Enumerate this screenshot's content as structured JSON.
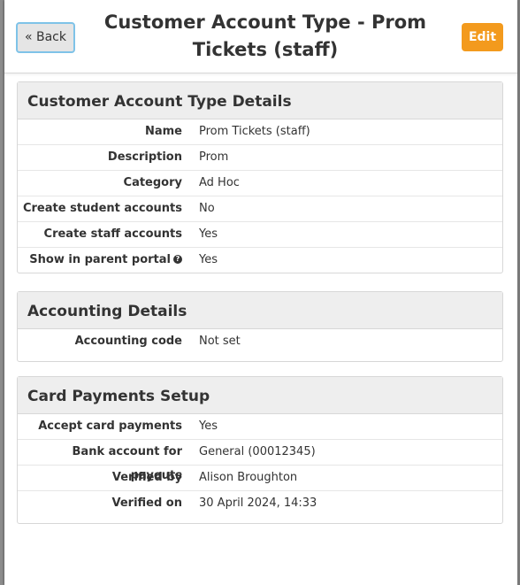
{
  "header": {
    "back_label": "« Back",
    "title": "Customer Account Type - Prom Tickets (staff)",
    "edit_label": "Edit"
  },
  "details": {
    "heading": "Customer Account Type Details",
    "rows": [
      {
        "label": "Name",
        "value": "Prom Tickets (staff)"
      },
      {
        "label": "Description",
        "value": "Prom"
      },
      {
        "label": "Category",
        "value": "Ad Hoc"
      },
      {
        "label": "Create student accounts",
        "value": "No"
      },
      {
        "label": "Create staff accounts",
        "value": "Yes"
      },
      {
        "label": "Show in parent portal",
        "value": "Yes",
        "icon": "help-icon"
      }
    ]
  },
  "accounting": {
    "heading": "Accounting Details",
    "rows": [
      {
        "label": "Accounting code",
        "value": "Not set"
      }
    ]
  },
  "card_payments": {
    "heading": "Card Payments Setup",
    "rows": [
      {
        "label": "Accept card payments",
        "value": "Yes"
      },
      {
        "label": "Bank account for payouts",
        "value": "General (00012345)"
      },
      {
        "label": "Verified by",
        "value": "Alison Broughton"
      },
      {
        "label": "Verified on",
        "value": "30 April 2024, 14:33"
      }
    ]
  },
  "colors": {
    "edit_button": "#f39a1d",
    "back_button_border": "#7fc3e8",
    "panel_header": "#eeeeee"
  }
}
